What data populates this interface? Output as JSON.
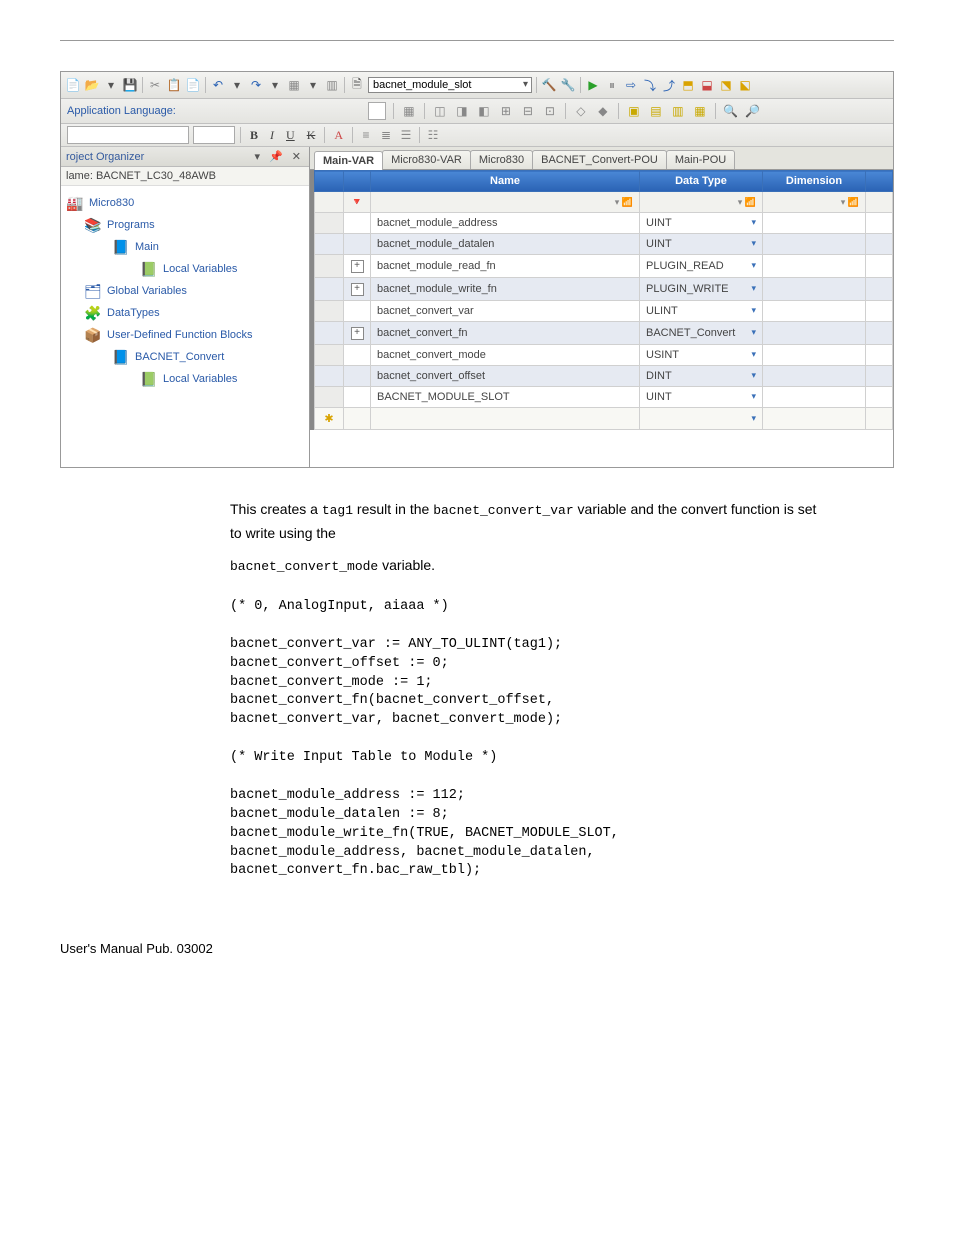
{
  "toolbar": {
    "combo_value": "bacnet_module_slot"
  },
  "appLangLabel": "Application Language:",
  "sidebar": {
    "title": "roject Organizer",
    "nameLabel": "lame:",
    "nameValue": "BACNET_LC30_48AWB",
    "nodes": [
      {
        "label": "Micro830",
        "indent": 0,
        "icon": "🏭"
      },
      {
        "label": "Programs",
        "indent": 1,
        "icon": "📚"
      },
      {
        "label": "Main",
        "indent": 2,
        "icon": "📘"
      },
      {
        "label": "Local Variables",
        "indent": 3,
        "icon": "📗"
      },
      {
        "label": "Global Variables",
        "indent": 1,
        "icon": "🗂"
      },
      {
        "label": "DataTypes",
        "indent": 1,
        "icon": "🧩"
      },
      {
        "label": "User-Defined Function Blocks",
        "indent": 1,
        "icon": "📦"
      },
      {
        "label": "BACNET_Convert",
        "indent": 2,
        "icon": "📘"
      },
      {
        "label": "Local Variables",
        "indent": 3,
        "icon": "📗"
      }
    ]
  },
  "tabs": [
    {
      "label": "Main-VAR",
      "active": true
    },
    {
      "label": "Micro830-VAR",
      "active": false
    },
    {
      "label": "Micro830",
      "active": false
    },
    {
      "label": "BACNET_Convert-POU",
      "active": false
    },
    {
      "label": "Main-POU",
      "active": false
    }
  ],
  "tableHeaders": {
    "name": "Name",
    "dataType": "Data Type",
    "dimension": "Dimension"
  },
  "rows": [
    {
      "name": "bacnet_module_address",
      "type": "UINT",
      "alt": false,
      "plus": false
    },
    {
      "name": "bacnet_module_datalen",
      "type": "UINT",
      "alt": true,
      "plus": false
    },
    {
      "name": "bacnet_module_read_fn",
      "type": "PLUGIN_READ",
      "alt": false,
      "plus": true
    },
    {
      "name": "bacnet_module_write_fn",
      "type": "PLUGIN_WRITE",
      "alt": true,
      "plus": true
    },
    {
      "name": "bacnet_convert_var",
      "type": "ULINT",
      "alt": false,
      "plus": false
    },
    {
      "name": "bacnet_convert_fn",
      "type": "BACNET_Convert",
      "alt": true,
      "plus": true
    },
    {
      "name": "bacnet_convert_mode",
      "type": "USINT",
      "alt": false,
      "plus": false
    },
    {
      "name": "bacnet_convert_offset",
      "type": "DINT",
      "alt": true,
      "plus": false
    },
    {
      "name": "BACNET_MODULE_SLOT",
      "type": "UINT",
      "alt": false,
      "plus": false
    }
  ],
  "bodyText": {
    "p1_a": "This creates a ",
    "p1_code1": "tag1",
    "p1_b": " result in the ",
    "p1_code2": "bacnet_convert_var",
    "p1_c": " variable and the convert function is set to write using the",
    "p2_code": "bacnet_convert_mode",
    "p2_a": " variable."
  },
  "code": "(* 0, AnalogInput, aiaaa *)\n\nbacnet_convert_var := ANY_TO_ULINT(tag1);\nbacnet_convert_offset := 0;\nbacnet_convert_mode := 1;\nbacnet_convert_fn(bacnet_convert_offset,\nbacnet_convert_var, bacnet_convert_mode);\n\n(* Write Input Table to Module *)\n\nbacnet_module_address := 112;\nbacnet_module_datalen := 8;\nbacnet_module_write_fn(TRUE, BACNET_MODULE_SLOT,\nbacnet_module_address, bacnet_module_datalen,\nbacnet_convert_fn.bac_raw_tbl);",
  "footer": {
    "left": "User's Manual Pub. 03002",
    "right": ""
  }
}
